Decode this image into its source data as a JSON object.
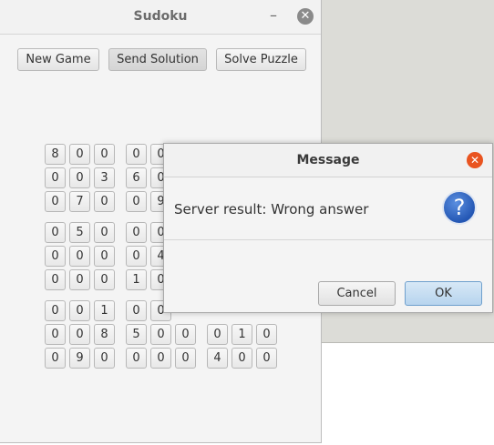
{
  "main_window": {
    "title": "Sudoku",
    "minimize_glyph": "–",
    "close_glyph": "✕"
  },
  "toolbar": {
    "new_game": "New Game",
    "send_solution": "Send Solution",
    "solve_puzzle": "Solve Puzzle"
  },
  "grid": {
    "visible_rows": [
      [
        "8",
        "0",
        "0",
        "0",
        "0"
      ],
      [
        "0",
        "0",
        "3",
        "6",
        "0"
      ],
      [
        "0",
        "7",
        "0",
        "0",
        "9"
      ],
      [
        "0",
        "5",
        "0",
        "0",
        "0"
      ],
      [
        "0",
        "0",
        "0",
        "0",
        "4"
      ],
      [
        "0",
        "0",
        "0",
        "1",
        "0"
      ],
      [
        "0",
        "0",
        "1",
        "0",
        "0"
      ],
      [
        "0",
        "0",
        "8",
        "5",
        "0",
        "0",
        "0",
        "1",
        "0"
      ],
      [
        "0",
        "9",
        "0",
        "0",
        "0",
        "0",
        "4",
        "0",
        "0"
      ]
    ]
  },
  "dialog": {
    "title": "Message",
    "close_glyph": "✕",
    "message": "Server result: Wrong answer",
    "icon": "question-icon",
    "icon_glyph": "?",
    "cancel": "Cancel",
    "ok": "OK"
  }
}
